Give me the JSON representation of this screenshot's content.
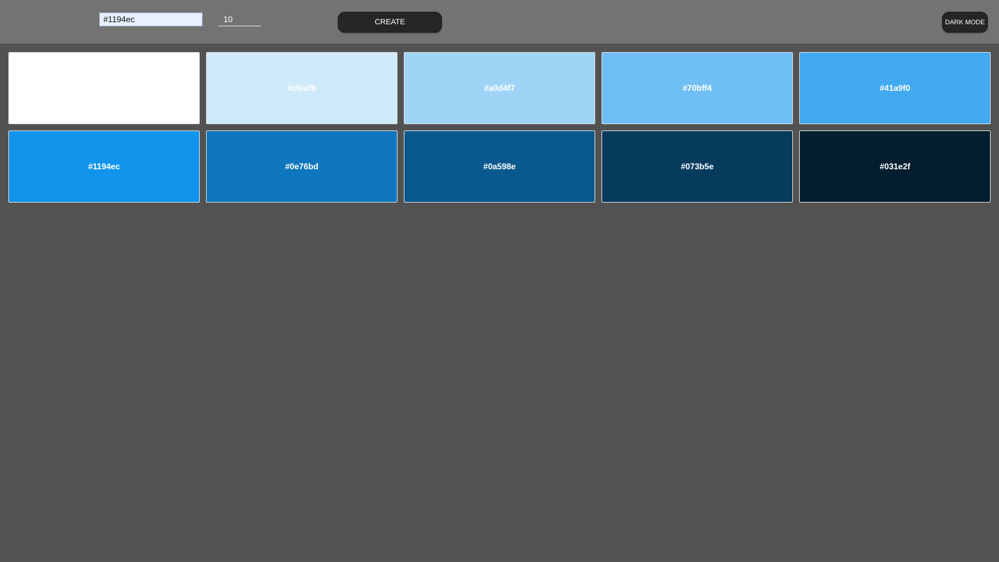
{
  "toolbar": {
    "color_value": "#1194ec",
    "count_value": "10",
    "create_label": "CREATE",
    "dark_mode_label": "DARK MODE"
  },
  "swatches": [
    {
      "hex": "#ffffff",
      "label": ""
    },
    {
      "hex": "#cfeafb",
      "label": "#cfeafb"
    },
    {
      "hex": "#a0d4f7",
      "label": "#a0d4f7"
    },
    {
      "hex": "#70bff4",
      "label": "#70bff4"
    },
    {
      "hex": "#41a9f0",
      "label": "#41a9f0"
    },
    {
      "hex": "#1194ec",
      "label": "#1194ec"
    },
    {
      "hex": "#0e76bd",
      "label": "#0e76bd"
    },
    {
      "hex": "#0a598e",
      "label": "#0a598e"
    },
    {
      "hex": "#073b5e",
      "label": "#073b5e"
    },
    {
      "hex": "#031e2f",
      "label": "#031e2f"
    }
  ]
}
